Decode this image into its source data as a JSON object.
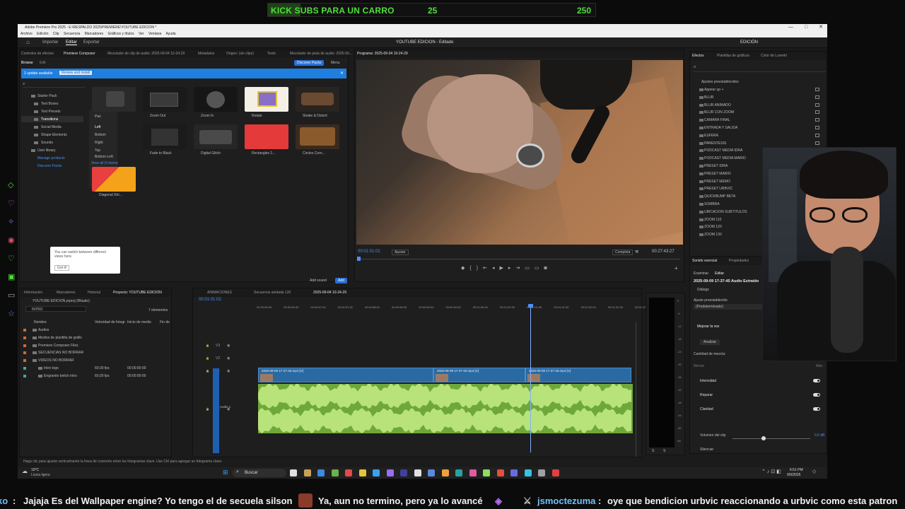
{
  "banner": {
    "title": "KICK SUBS PARA UN CARRO",
    "current": "25",
    "goal": "250",
    "progress_fraction": 0.1,
    "accent": "#4fe03a"
  },
  "window": {
    "title": "Adobe Premiere Pro 2025 - E:\\RESPALDO 2025\\PREMIERE\\YOUTUBE EDICION *",
    "menu": [
      "Archivo",
      "Edición",
      "Clip",
      "Secuencia",
      "Marcadores",
      "Gráficos y títulos",
      "Ver",
      "Ventana",
      "Ayuda"
    ],
    "controls": [
      "—",
      "□",
      "✕"
    ]
  },
  "workspace": {
    "tabs": [
      "Importar",
      "Editar",
      "Exportar"
    ],
    "active_tab": "Editar",
    "center_title": "YOUTUBE EDICION - Editado",
    "right_label": "EDICIÓN"
  },
  "left_panel": {
    "tabs": [
      "Controles de efectos",
      "Premiere Composer",
      "Mezclador de clip de audio: 2025-09-04 10-24-29",
      "Metadatos",
      "Origen: (sin clips)",
      "Texto",
      "Mezclador de pista de audio: 2025-09..."
    ],
    "subtabs": [
      "Browse",
      "Edit"
    ],
    "discover_button": "Discover Packs",
    "menu_label": "Menu",
    "update_text": "1 update available",
    "update_button": "Review and install",
    "tree": [
      "Starter Pack",
      "Text Boxes",
      "Text Presets",
      "Transitions",
      "Social Media",
      "Shape Elements",
      "Sounds",
      "User library",
      "Manage products",
      "Discover Packs"
    ],
    "submenu": [
      "Pan",
      "Left",
      "Bottom",
      "Right",
      "Top",
      "Bottom-Left",
      "View all (4 items)"
    ],
    "templates": [
      "Zoom Out",
      "Zoom In",
      "Rotate",
      "Shake & Distort",
      "Fade to Black",
      "Digital Glitch",
      "Rectangles 2...",
      "Circles Corn...",
      "Diagonal Stri..."
    ],
    "tooltip": "You can switch between different views here.",
    "tooltip_button": "Got it!",
    "add_sound": "Add sound",
    "add_button": "Add"
  },
  "program": {
    "title": "Programa: 2025-09-04 10-24-29",
    "timecode": "00:01:01:02",
    "fit": "Ajustar",
    "quality": "Completa",
    "duration": "00:27:43:27"
  },
  "effects_panel": {
    "tabs": [
      "Efectos",
      "Plantillas de gráficos",
      "Color de Lumetri"
    ],
    "folder": "Ajustes preestablecidos",
    "items": [
      "Appear up +",
      "BLUR",
      "BLUR ANIMADO",
      "BLUR CON ZOOM",
      "CAMARA FINAL",
      "ENTRADA Y SALIDA",
      "ESFERA",
      "PARENTESIS",
      "PODCAST MEDIA IDRA",
      "PODCAST MEDIA MARIO",
      "PRESET IDRA",
      "PRESET MARIO",
      "PRESET MEMO",
      "PRESET URBVIC",
      "QUICKBUMP BETA",
      "SOMBRA",
      "UBICACION SUBTITULOS",
      "ZOOM 110",
      "ZOOM 120",
      "ZOOM 130"
    ]
  },
  "essential_sound": {
    "tabs": [
      "Sonido esencial",
      "Propiedades"
    ],
    "subtabs": [
      "Examinar",
      "Editar"
    ],
    "clip_name": "2025-09-09 17-37-45 Audio Extraído",
    "type": "Diálogo",
    "preset_label": "Ajuste preestablecido",
    "preset_value": "(Predeterminado)",
    "section": "Mejorar la voz",
    "analyze_button": "Analizar",
    "mix_label": "Cantidad de mezcla:",
    "scale_low": "Menos",
    "scale_high": "Más",
    "rows": [
      "Intensidad",
      "Reparar",
      "Claridad"
    ],
    "clip_volume": "Volumen del clip",
    "clip_volume_value": "0.0 dB",
    "mute": "Silenciar"
  },
  "project_panel": {
    "tabs": [
      "Información",
      "Marcadores",
      "Historial",
      "Proyecto: YOUTUBE EDICION"
    ],
    "file": "YOUTUBE EDICION.prproj (Ritualo)",
    "search_value": "INTRO",
    "count": "7 elementos",
    "columns": [
      "Nombre",
      "Velocidad de fotogr.",
      "Inicio de medio",
      "Fin de"
    ],
    "rows": [
      {
        "name": "Audios",
        "fps": "",
        "start": ""
      },
      {
        "name": "Medios de plantilla de gráfic",
        "fps": "",
        "start": ""
      },
      {
        "name": "Premiere Composer Files",
        "fps": "",
        "start": ""
      },
      {
        "name": "SECUENCIAS NO BORRAR",
        "fps": "",
        "start": ""
      },
      {
        "name": "VIDEOS NO BORRAR",
        "fps": "",
        "start": ""
      },
      {
        "name": "Intro logo",
        "fps": "60,00 fps",
        "start": "00:00:00:00"
      },
      {
        "name": "Engranito belich intro",
        "fps": "60,00 fps",
        "start": "00:00:00:00"
      }
    ]
  },
  "timeline": {
    "tabs": [
      "ANIMACIONES",
      "Secuencia anidada 120",
      "2025-09-04 10-24-29"
    ],
    "timecode": "00:01:01:02",
    "ruler": [
      "00:00:56:00",
      "00:00:56:30",
      "00:00:57:00",
      "00:00:57:30",
      "00:00:58:00",
      "00:00:58:30",
      "00:00:59:00",
      "00:00:59:30",
      "00:01:00:00",
      "00:01:00:30",
      "00:01:01:00",
      "00:01:01:30",
      "00:01:02:00",
      "00:01:02:30",
      "00:01:03:"
    ],
    "tracks": [
      "V3",
      "V2",
      "V1",
      "A1"
    ],
    "audio_label": "Audio 1",
    "clips": [
      "2025-09-09 17-37-45.mp4 [V]",
      "2025-09-09 17-37-45.mp4 [V]",
      "2025-09-09 17-37-45.mp4 [V]"
    ],
    "meter_scale": [
      "0",
      "-6",
      "-12",
      "-18",
      "-24",
      "-30",
      "-36",
      "-42",
      "-48",
      "-54",
      "-60",
      "dB"
    ],
    "meter_bottom": [
      "S",
      "S"
    ]
  },
  "status_bar": "Haga clic para ajustar verticalmente la línea de conexión entre los fotogramas clave. Use Ctrl para agregar un fotograma clave.",
  "taskbar": {
    "weather_temp": "19°C",
    "weather_desc": "Lluvia ligera",
    "search": "Buscar",
    "time": "6:51 PM",
    "date": "9/9/2025"
  },
  "chat": [
    {
      "user": "ko",
      "text": "Jajaja Es del Wallpaper engine? Yo tengo el de secuela silson"
    },
    {
      "user": "",
      "text": "Ya, aun no termino, pero ya lo avancé"
    },
    {
      "user": "jsmoctezuma",
      "text": "oye que bendicion urbvic reaccionando a urbvic como esta patron"
    }
  ],
  "colors": {
    "video_clip": "#2a6aa3",
    "audio_clip": "#8cc44a",
    "accent_blue": "#2b6fd6",
    "playhead": "#4d8ff5"
  }
}
